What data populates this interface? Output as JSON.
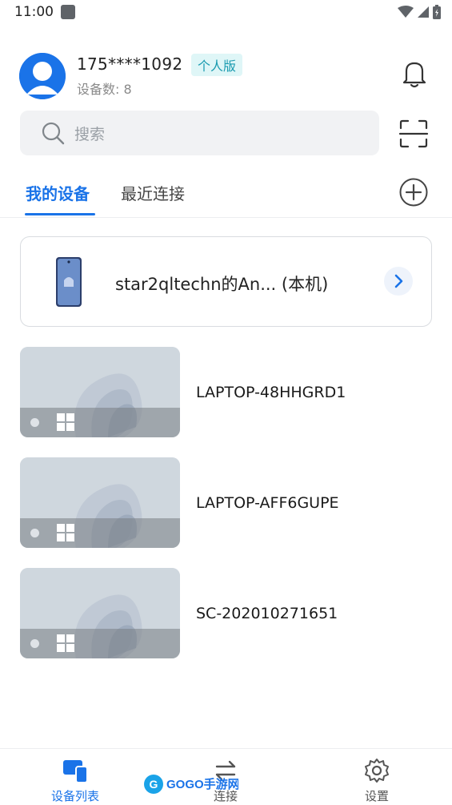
{
  "status_bar": {
    "time": "11:00"
  },
  "account": {
    "phone": "175****1092",
    "plan": "个人版",
    "device_count": "设备数: 8"
  },
  "search": {
    "placeholder": "搜索"
  },
  "tabs": [
    {
      "label": "我的设备",
      "active": true
    },
    {
      "label": "最近连接",
      "active": false
    }
  ],
  "local_device": {
    "name": "star2qltechn的An... (本机)"
  },
  "devices": [
    {
      "name": "LAPTOP-48HHGRD1",
      "os": "windows-icon"
    },
    {
      "name": "LAPTOP-AFF6GUPE",
      "os": "windows-icon"
    },
    {
      "name": "SC-202010271651",
      "os": "windows-icon"
    }
  ],
  "bottom_nav": [
    {
      "label": "设备列表",
      "icon": "device-list-icon",
      "active": true
    },
    {
      "label": "连接",
      "icon": "connect-icon",
      "active": false
    },
    {
      "label": "设置",
      "icon": "gear-icon",
      "active": false
    }
  ],
  "watermark": {
    "text": "GOGO手游网"
  },
  "colors": {
    "accent": "#1a73e8",
    "badge_bg": "#dff6f7",
    "badge_text": "#1a9bb0"
  }
}
